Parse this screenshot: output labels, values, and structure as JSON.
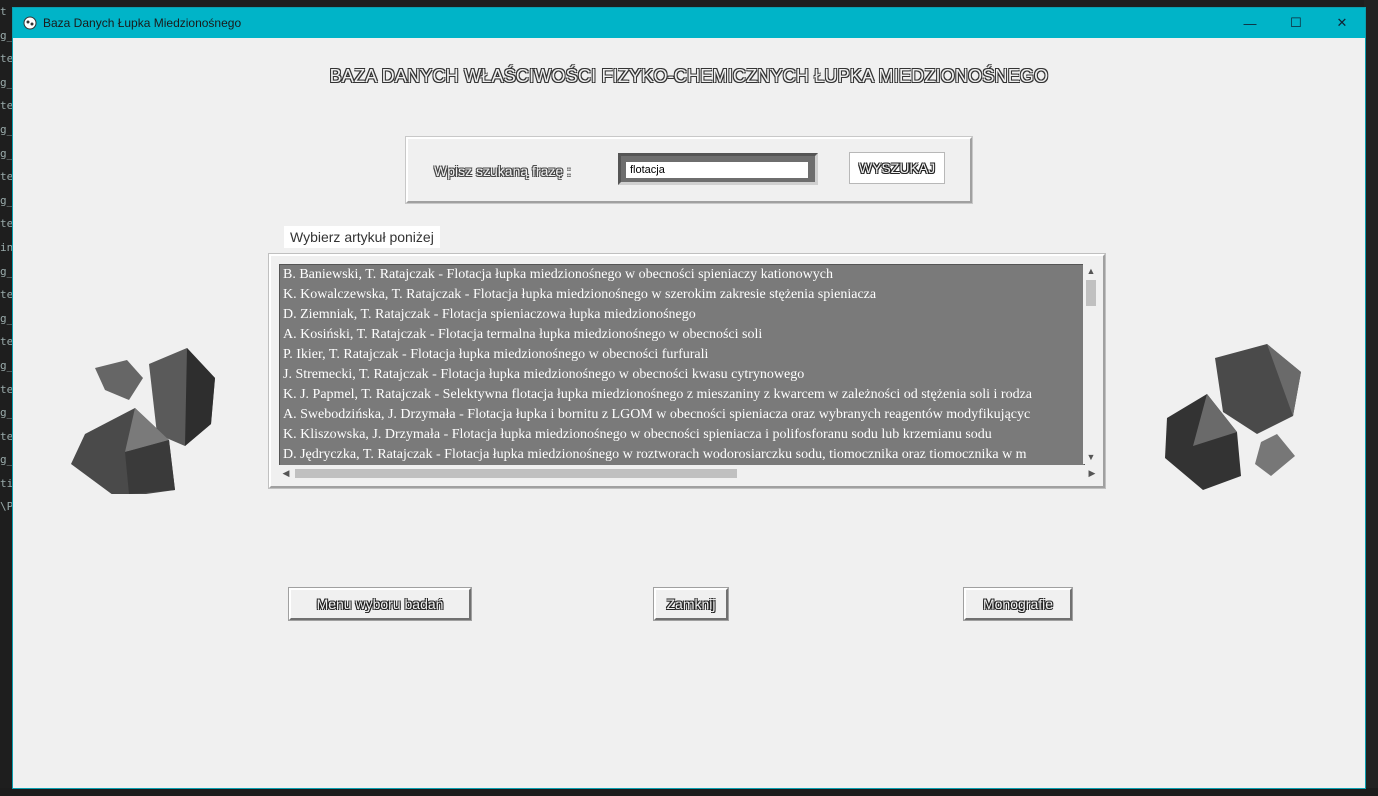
{
  "window": {
    "title": "Baza Danych Łupka Miedzionośnego",
    "controls": {
      "minimize": "—",
      "maximize": "☐",
      "close": "✕"
    }
  },
  "heading": "BAZA DANYCH WŁAŚCIWOŚCI FIZYKO-CHEMICZNYCH ŁUPKA MIEDZIONOŚNEGO",
  "search": {
    "label": "Wpisz szukaną frazę :",
    "value": "flotacja",
    "button": "WYSZUKAJ"
  },
  "articles": {
    "label": "Wybierz artykuł poniżej",
    "items": [
      "B. Baniewski, T. Ratajczak - Flotacja łupka miedzionośnego w obecności spieniaczy kationowych",
      "K. Kowalczewska, T. Ratajczak - Flotacja łupka miedzionośnego w szerokim zakresie stężenia spieniacza",
      "D. Ziemniak, T. Ratajczak - Flotacja spieniaczowa łupka miedzionośnego",
      "A. Kosiński, T. Ratajczak - Flotacja termalna łupka miedzionośnego w obecności soli",
      "P. Ikier, T. Ratajczak - Flotacja łupka miedzionośnego w obecności furfurali",
      "J. Stremecki, T. Ratajczak - Flotacja łupka miedzionośnego w obecności kwasu cytrynowego",
      "K. J. Papmel, T. Ratajczak - Selektywna flotacja łupka miedzionośnego z mieszaniny z kwarcem w zależności od stężenia soli i rodza",
      "A. Swebodzińska, J. Drzymała - Flotacja łupka i bornitu z LGOM w obecności spieniacza oraz wybranych reagentów modyfikującyc",
      "K. Kliszowska, J. Drzymała - Flotacja łupka miedzionośnego w obecności spieniacza i polifosforanu sodu lub krzemianu sodu",
      "D. Jędryczka, T. Ratajczak - Flotacja łupka miedzionośnego w roztworach wodorosiarczku sodu, tiomocznika oraz tiomocznika w m"
    ]
  },
  "buttons": {
    "menu": "Menu wyboru badań",
    "close": "Zamknij",
    "monographs": "Monografie"
  },
  "background_terminal": [
    "t",
    "g_",
    "te",
    "g_",
    "te",
    "g_",
    "g_",
    "te",
    "g_",
    "te",
    "in",
    "g_",
    "te",
    "g_",
    "te",
    "g_",
    "te",
    "g_",
    "te",
    "g_",
    "tic",
    "",
    "\\P"
  ],
  "colors": {
    "titlebar": "#00b4c8",
    "window": "#f0f0f0",
    "listbox": "#7a7a7a"
  },
  "icons": [
    "app-icon",
    "rock-left-icon",
    "rock-right-icon"
  ]
}
